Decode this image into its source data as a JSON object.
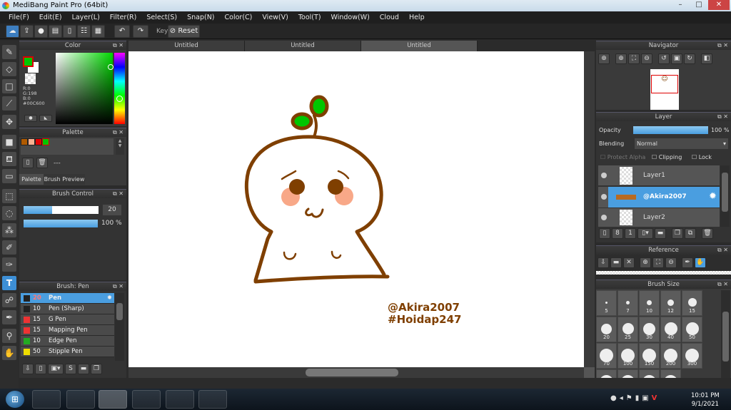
{
  "window": {
    "title": "MediBang Paint Pro (64bit)"
  },
  "menu": [
    "File(F)",
    "Edit(E)",
    "Layer(L)",
    "Filter(R)",
    "Select(S)",
    "Snap(N)",
    "Color(C)",
    "View(V)",
    "Tool(T)",
    "Window(W)",
    "Cloud",
    "Help"
  ],
  "toolbar": {
    "key_label": "Key",
    "reset_label": "Reset"
  },
  "doc_tabs": [
    "Untitled",
    "Untitled",
    "Untitled"
  ],
  "color_panel": {
    "title": "Color",
    "r": "R:0",
    "g": "G:198",
    "b": "B:0",
    "hex": "#00C600",
    "fg": "#00C600",
    "bg": "#FFFFFF"
  },
  "palette_panel": {
    "title": "Palette",
    "swatches": [
      "#B05A00",
      "#F8B090",
      "#E00000",
      "#00C600"
    ],
    "name": "---",
    "tabs": [
      "Palette",
      "Brush Preview"
    ]
  },
  "brush_control": {
    "title": "Brush Control",
    "size": "20",
    "opacity": "100 %",
    "size_fraction": 0.38,
    "opacity_fraction": 1.0
  },
  "brush_panel": {
    "title": "Brush: Pen",
    "items": [
      {
        "size": "20",
        "name": "Pen",
        "color": "#222222",
        "selected": true
      },
      {
        "size": "10",
        "name": "Pen (Sharp)",
        "color": "#222222"
      },
      {
        "size": "15",
        "name": "G Pen",
        "color": "#EE3333"
      },
      {
        "size": "15",
        "name": "Mapping Pen",
        "color": "#EE3333"
      },
      {
        "size": "10",
        "name": "Edge Pen",
        "color": "#22AA22"
      },
      {
        "size": "50",
        "name": "Stipple Pen",
        "color": "#EED000"
      }
    ]
  },
  "canvas": {
    "watermark1": "@Akira2007",
    "watermark2": "#Hoidap247",
    "stroke": "#7F3F00",
    "leaf": "#00C600",
    "cheek": "#F8A888"
  },
  "navigator": {
    "title": "Navigator"
  },
  "layer_panel": {
    "title": "Layer",
    "opacity_label": "Opacity",
    "opacity": "100 %",
    "blending_label": "Blending",
    "blending": "Normal",
    "protect_alpha": "Protect Alpha",
    "clipping": "Clipping",
    "lock": "Lock",
    "layers": [
      {
        "name": "Layer1"
      },
      {
        "name": "@Akira2007",
        "selected": true
      },
      {
        "name": "Layer2"
      }
    ]
  },
  "reference": {
    "title": "Reference"
  },
  "brush_size": {
    "title": "Brush Size",
    "sizes": [
      "5",
      "7",
      "10",
      "12",
      "15",
      "20",
      "25",
      "30",
      "40",
      "50",
      "70",
      "100",
      "150",
      "200",
      "300"
    ]
  },
  "taskbar": {
    "time": "10:01 PM",
    "date": "9/1/2021"
  }
}
